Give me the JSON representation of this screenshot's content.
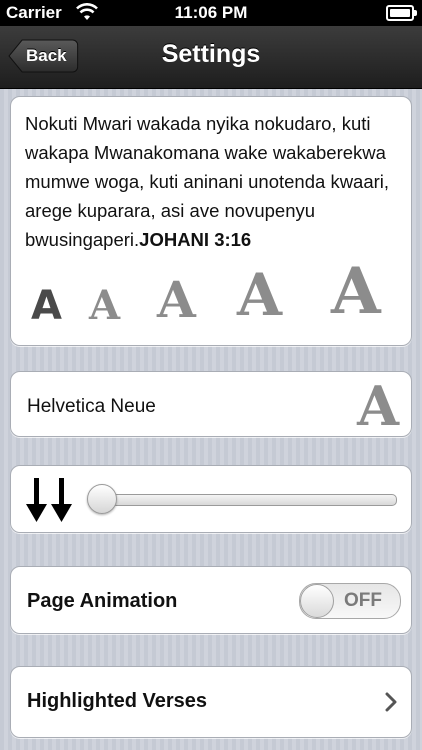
{
  "status_bar": {
    "carrier": "Carrier",
    "time": "11:06 PM",
    "battery_level": 1.0
  },
  "nav": {
    "back_label": "Back",
    "title": "Settings"
  },
  "verse": {
    "text": "Nokuti Mwari wakada nyika nokudaro, kuti wakapa Mwanakomana wake wakaberekwa mumwe woga, kuti aninani unotenda kwaari, arege kuparara, asi ave novupenyu bwusingaperi.",
    "reference": "JOHANI 3:16"
  },
  "font_sizes": {
    "options": [
      "A",
      "A",
      "A",
      "A",
      "A"
    ],
    "selected_index": 0
  },
  "font": {
    "name": "Helvetica Neue",
    "preview": "A"
  },
  "scroll_speed": {
    "icon": "double-down-arrow-icon",
    "value": 0
  },
  "page_animation": {
    "label": "Page Animation",
    "state": "OFF"
  },
  "highlighted_verses": {
    "label": "Highlighted Verses"
  },
  "colors": {
    "nav_bar": "#2a2a2a",
    "background": "#c7ccd6",
    "font_preview": "#8c8c8c"
  }
}
